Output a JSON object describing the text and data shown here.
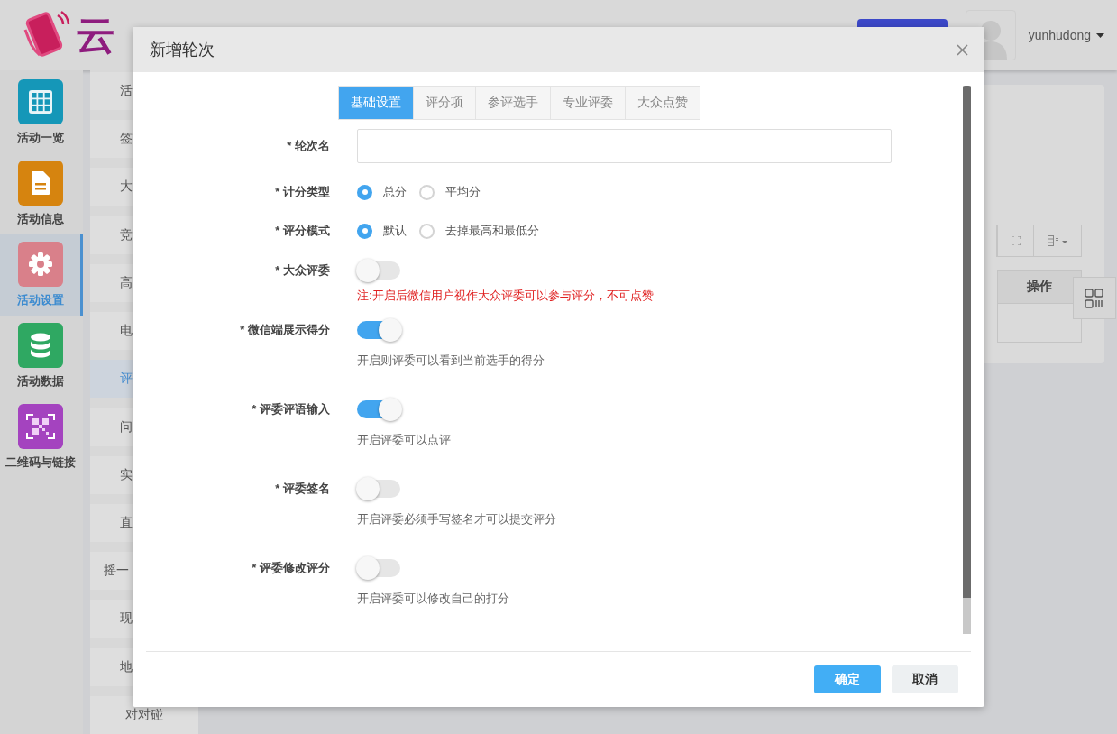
{
  "header": {
    "logo_text": "云",
    "user": "yunhudong"
  },
  "nav": {
    "items": [
      {
        "label": "活动一览",
        "selected": false,
        "color": "#1597b8"
      },
      {
        "label": "活动信息",
        "selected": false,
        "color": "#d6840f"
      },
      {
        "label": "活动设置",
        "selected": true,
        "color": "#d9808a"
      },
      {
        "label": "活动数据",
        "selected": false,
        "color": "#2fa862"
      },
      {
        "label": "二维码与链接",
        "selected": false,
        "color": "#a443bf"
      }
    ]
  },
  "subnav": {
    "items": [
      {
        "label": "活",
        "selected": false
      },
      {
        "label": "签",
        "selected": false
      },
      {
        "label": "大",
        "selected": false
      },
      {
        "label": "竞",
        "selected": false
      },
      {
        "label": "高",
        "selected": false
      },
      {
        "label": "电",
        "selected": false
      },
      {
        "label": "评",
        "selected": true
      },
      {
        "label": "问",
        "selected": false
      },
      {
        "label": "实",
        "selected": false
      },
      {
        "label": "直",
        "selected": false
      },
      {
        "label": "摇一",
        "selected": false
      },
      {
        "label": "现",
        "selected": false
      },
      {
        "label": "地",
        "selected": false
      },
      {
        "label": "对对碰",
        "selected": false
      }
    ]
  },
  "table": {
    "columns": [
      "操作"
    ]
  },
  "dialog": {
    "title": "新增轮次",
    "tabs": [
      {
        "label": "基础设置",
        "selected": true
      },
      {
        "label": "评分项",
        "selected": false
      },
      {
        "label": "参评选手",
        "selected": false
      },
      {
        "label": "专业评委",
        "selected": false
      },
      {
        "label": "大众点赞",
        "selected": false
      }
    ],
    "fields": [
      {
        "kind": "text",
        "label": "* 轮次名"
      },
      {
        "kind": "radio",
        "label": "* 计分类型",
        "options": [
          {
            "label": "总分",
            "selected": true
          },
          {
            "label": "平均分",
            "selected": false
          }
        ]
      },
      {
        "kind": "radio",
        "label": "* 评分模式",
        "options": [
          {
            "label": "默认",
            "selected": true
          },
          {
            "label": "去掉最高和最低分",
            "selected": false
          }
        ]
      },
      {
        "kind": "switch",
        "label": "* 大众评委",
        "on": false,
        "warning": "注:开启后微信用户视作大众评委可以参与评分，不可点赞"
      },
      {
        "kind": "switch",
        "label": "* 微信端展示得分",
        "on": true,
        "help": "开启则评委可以看到当前选手的得分"
      },
      {
        "kind": "switch",
        "label": "* 评委评语输入",
        "on": true,
        "help": "开启评委可以点评"
      },
      {
        "kind": "switch",
        "label": "* 评委签名",
        "on": false,
        "help": "开启评委必须手写签名才可以提交评分"
      },
      {
        "kind": "switch",
        "label": "* 评委修改评分",
        "on": false,
        "help": "开启评委可以修改自己的打分"
      }
    ],
    "buttons": [
      {
        "label": "确定",
        "kind": "primary"
      },
      {
        "label": "取消",
        "kind": "default"
      }
    ]
  }
}
